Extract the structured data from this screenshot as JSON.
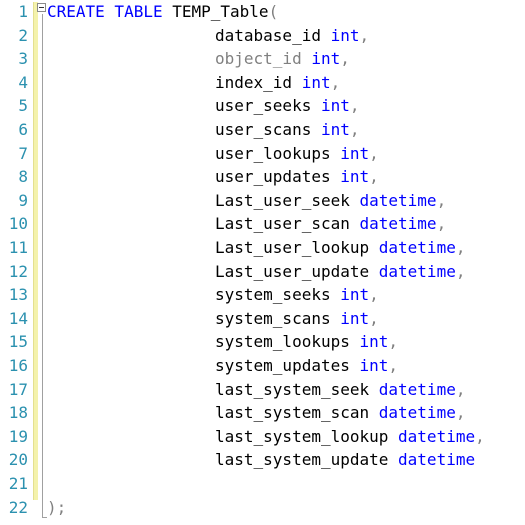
{
  "editor": {
    "line_numbers": [
      "1",
      "2",
      "3",
      "4",
      "5",
      "6",
      "7",
      "8",
      "9",
      "10",
      "11",
      "12",
      "13",
      "14",
      "15",
      "16",
      "17",
      "18",
      "19",
      "20",
      "21",
      "22"
    ],
    "create_keyword": "CREATE TABLE",
    "table_name": "TEMP_Table",
    "open_paren": "(",
    "close_paren": ");",
    "columns": [
      {
        "name": "database_id",
        "type": "int",
        "sep": ","
      },
      {
        "name": "object_id",
        "type": "int",
        "sep": ","
      },
      {
        "name": "index_id",
        "type": "int",
        "sep": ","
      },
      {
        "name": "user_seeks",
        "type": "int",
        "sep": ","
      },
      {
        "name": "user_scans",
        "type": "int",
        "sep": ","
      },
      {
        "name": "user_lookups",
        "type": "int",
        "sep": ","
      },
      {
        "name": "user_updates",
        "type": "int",
        "sep": ","
      },
      {
        "name": "Last_user_seek",
        "type": "datetime",
        "sep": ","
      },
      {
        "name": "Last_user_scan",
        "type": "datetime",
        "sep": ","
      },
      {
        "name": "Last_user_lookup",
        "type": "datetime",
        "sep": ","
      },
      {
        "name": "Last_user_update",
        "type": "datetime",
        "sep": ","
      },
      {
        "name": "system_seeks",
        "type": "int",
        "sep": ","
      },
      {
        "name": "system_scans",
        "type": "int",
        "sep": ","
      },
      {
        "name": "system_lookups",
        "type": "int",
        "sep": ","
      },
      {
        "name": "system_updates",
        "type": "int",
        "sep": ","
      },
      {
        "name": "last_system_seek",
        "type": "datetime",
        "sep": ","
      },
      {
        "name": "last_system_scan",
        "type": "datetime",
        "sep": ","
      },
      {
        "name": "last_system_lookup",
        "type": "datetime",
        "sep": ","
      },
      {
        "name": "last_system_update",
        "type": "datetime",
        "sep": ""
      }
    ],
    "colors": {
      "keyword": "#0000ff",
      "line_number": "#2b91af",
      "identifier": "#000000",
      "punctuation": "#808080",
      "highlighted_identifier": "#808080",
      "change_bar": "#f4f2ac"
    }
  }
}
